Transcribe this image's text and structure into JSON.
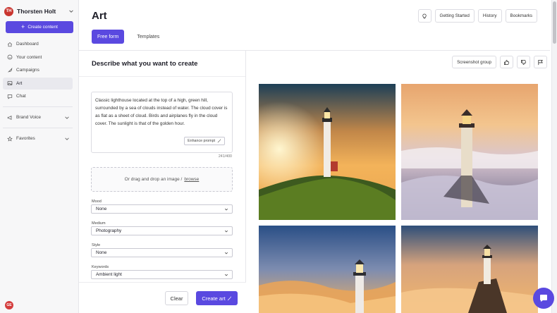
{
  "user": {
    "initials": "TH",
    "name": "Thorsten Holt"
  },
  "sidebar": {
    "create_label": "Create content",
    "items": [
      {
        "label": "Dashboard",
        "icon": "home-icon"
      },
      {
        "label": "Your content",
        "icon": "smile-icon"
      },
      {
        "label": "Campaigns",
        "icon": "rocket-icon"
      },
      {
        "label": "Art",
        "icon": "image-icon",
        "active": true
      },
      {
        "label": "Chat",
        "icon": "chat-icon"
      }
    ],
    "brand_voice": "Brand Voice",
    "favorites": "Favorites",
    "bottom_avatar": "GE"
  },
  "page": {
    "title": "Art",
    "header_buttons": [
      "Getting Started",
      "History",
      "Bookmarks"
    ],
    "tabs": [
      "Free form",
      "Templates"
    ]
  },
  "form": {
    "heading": "Describe what you want to create",
    "prompt": "Classic lighthouse located at the top of a high, green hill, surrounded by a sea of clouds instead of water. The cloud cover is as flat as a sheet of cloud. Birds and airplanes fly in the cloud cover. The sunlight is that of the golden hour.",
    "enhance_label": "Enhance prompt",
    "char_count": "241/400",
    "drop_text": "Or drag and drop an image /",
    "drop_link": "browse",
    "fields": [
      {
        "label": "Mood",
        "value": "None"
      },
      {
        "label": "Medium",
        "value": "Photography"
      },
      {
        "label": "Style",
        "value": "None"
      },
      {
        "label": "Keywords",
        "value": "Ambient light"
      }
    ],
    "clear_label": "Clear",
    "create_label": "Create art"
  },
  "results": {
    "screenshot_group_label": "Screenshot group"
  },
  "colors": {
    "accent": "#5a49e0",
    "avatar": "#c9352f"
  }
}
